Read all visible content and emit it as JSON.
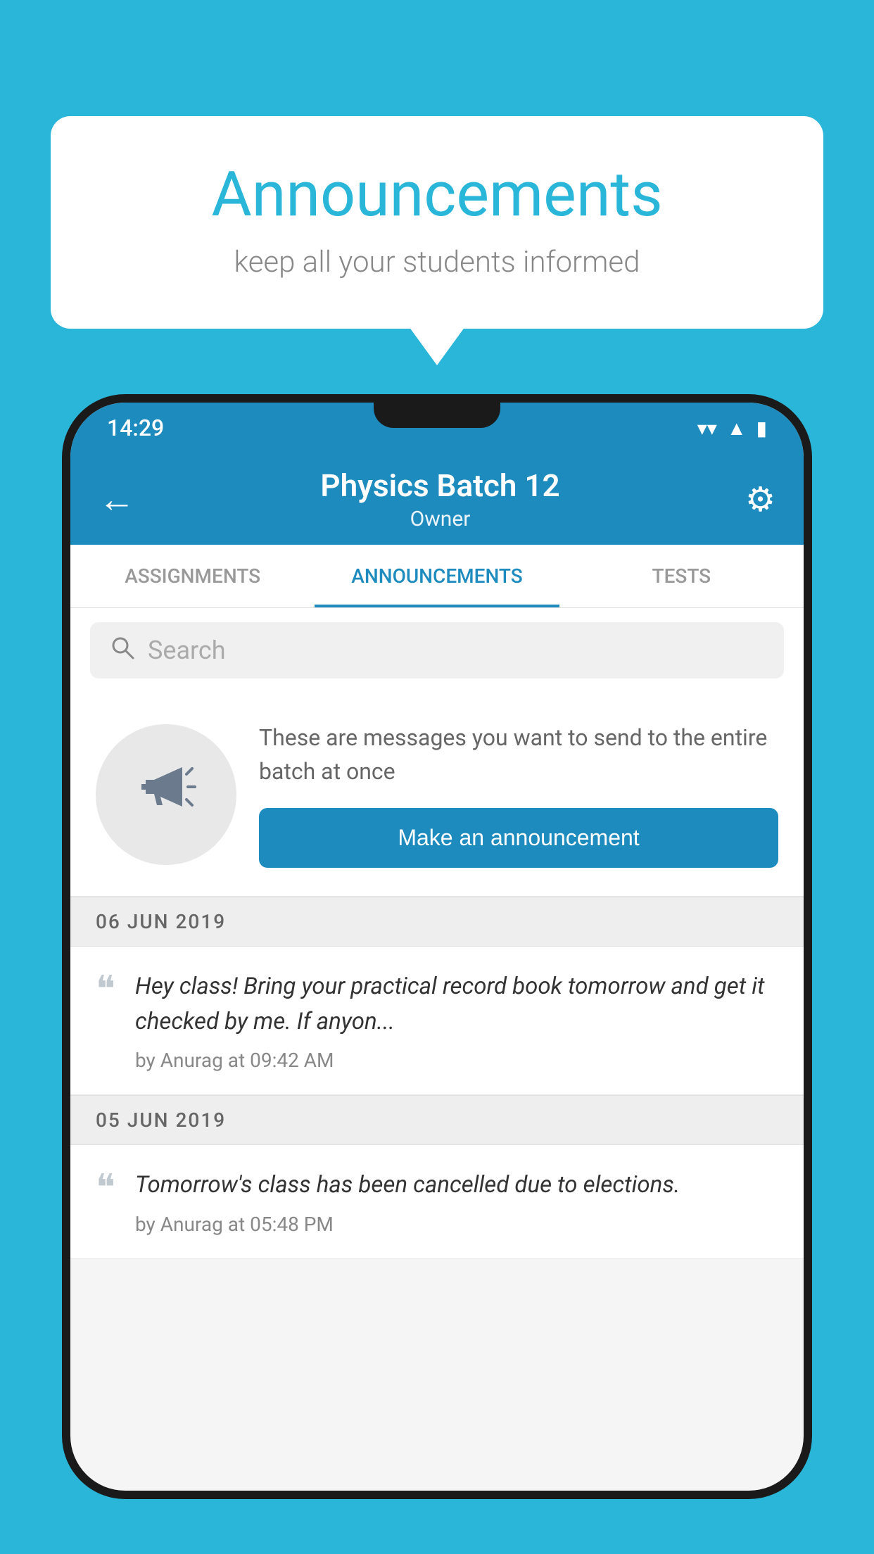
{
  "bubble": {
    "title": "Announcements",
    "subtitle": "keep all your students informed"
  },
  "statusBar": {
    "time": "14:29"
  },
  "appBar": {
    "title": "Physics Batch 12",
    "subtitle": "Owner",
    "backArrow": "←",
    "settingsIcon": "⚙"
  },
  "tabs": [
    {
      "label": "ASSIGNMENTS",
      "active": false
    },
    {
      "label": "ANNOUNCEMENTS",
      "active": true
    },
    {
      "label": "TESTS",
      "active": false
    }
  ],
  "search": {
    "placeholder": "Search"
  },
  "announcementPrompt": {
    "description": "These are messages you want to send to the entire batch at once",
    "buttonLabel": "Make an announcement"
  },
  "announcements": [
    {
      "date": "06  JUN  2019",
      "text": "Hey class! Bring your practical record book tomorrow and get it checked by me. If anyon...",
      "meta": "by Anurag at 09:42 AM"
    },
    {
      "date": "05  JUN  2019",
      "text": "Tomorrow's class has been cancelled due to elections.",
      "meta": "by Anurag at 05:48 PM"
    }
  ]
}
